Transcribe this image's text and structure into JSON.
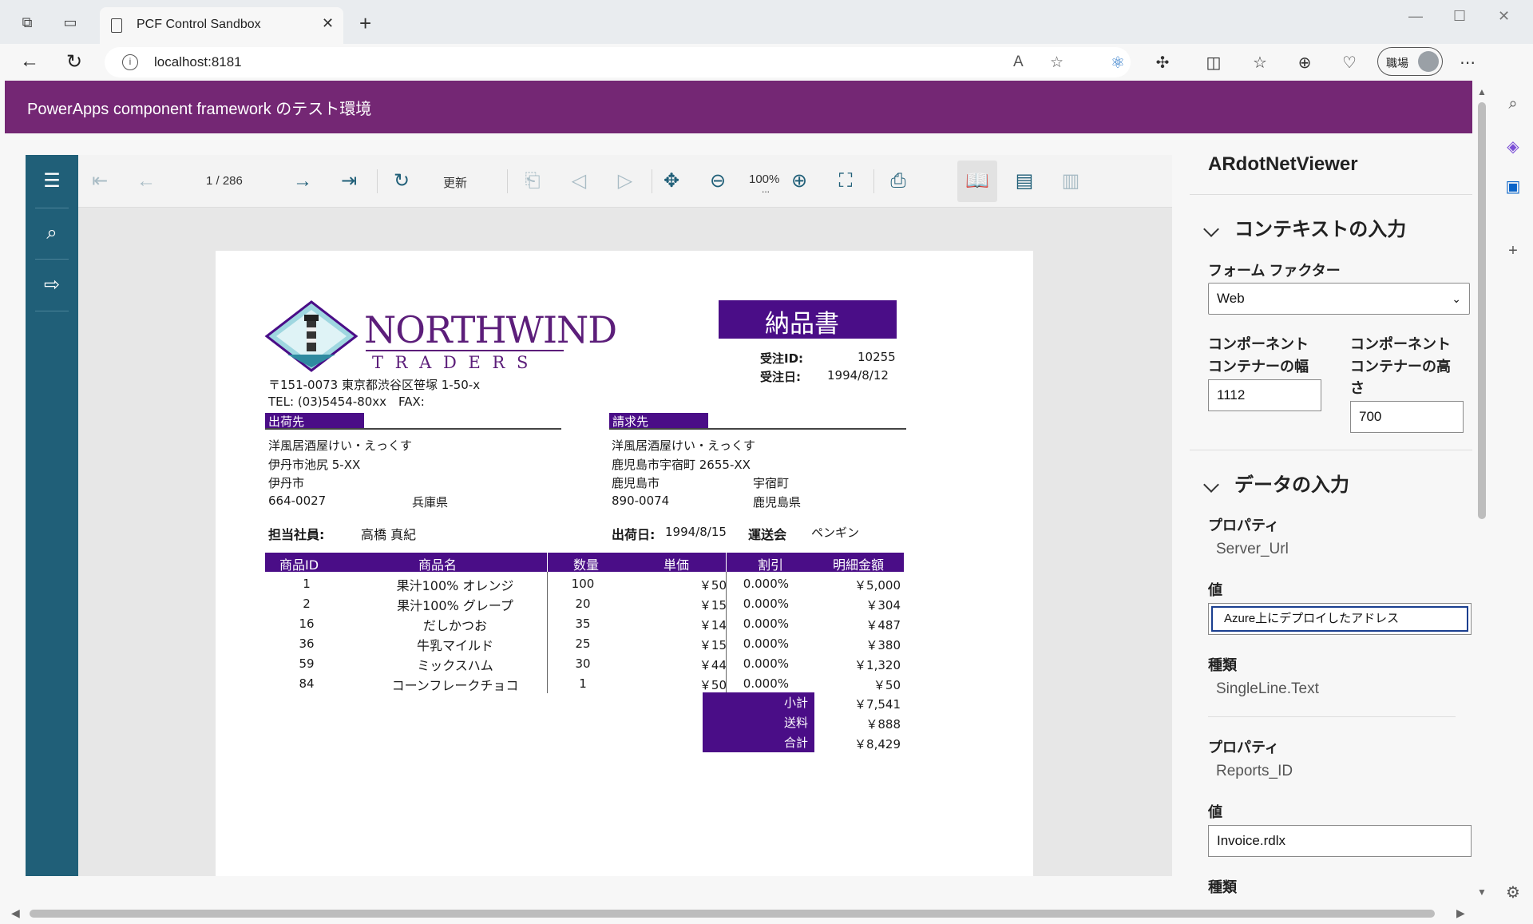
{
  "browser": {
    "tab_title": "PCF Control Sandbox",
    "url": "localhost:8181",
    "profile_label": "職場"
  },
  "app": {
    "banner_title": "PowerApps component framework のテスト環境"
  },
  "viewer": {
    "page_indicator": "1 / 286",
    "refresh_label": "更新",
    "zoom": "100%",
    "zoom_sub": "...",
    "accent_color": "#205f78"
  },
  "invoice": {
    "company_name_line1": "NORTHWIND",
    "company_name_line2": "T R A D E R S",
    "address": "〒151-0073 東京都渋谷区笹塚 1-50-x",
    "tel": "TEL: (03)5454-80xx",
    "fax": "FAX:",
    "doc_title": "納品書",
    "order_id_label": "受注ID:",
    "order_id": "10255",
    "order_date_label": "受注日:",
    "order_date": "1994/8/12",
    "ship_to_label": "出荷先",
    "bill_to_label": "請求先",
    "ship_to": {
      "name": "洋風居酒屋けい・えっくす",
      "address": "伊丹市池尻 5-XX",
      "city": "伊丹市",
      "postal": "664-0027",
      "pref": "兵庫県"
    },
    "bill_to": {
      "name": "洋風居酒屋けい・えっくす",
      "address": "鹿児島市宇宿町 2655-XX",
      "city": "鹿児島市",
      "town": "宇宿町",
      "postal": "890-0074",
      "pref": "鹿児島県"
    },
    "staff_label": "担当社員:",
    "staff": "高橋 真紀",
    "ship_date_label": "出荷日:",
    "ship_date": "1994/8/15",
    "carrier_label": "運送会",
    "carrier": "ペンギン",
    "columns": [
      "商品ID",
      "商品名",
      "数量",
      "単価",
      "割引",
      "明細金額"
    ],
    "rows": [
      {
        "id": "1",
        "name": "果汁100% オレンジ",
        "qty": "100",
        "price": "￥50",
        "disc": "0.000%",
        "amount": "￥5,000"
      },
      {
        "id": "2",
        "name": "果汁100% グレープ",
        "qty": "20",
        "price": "￥15",
        "disc": "0.000%",
        "amount": "￥304"
      },
      {
        "id": "16",
        "name": "だしかつお",
        "qty": "35",
        "price": "￥14",
        "disc": "0.000%",
        "amount": "￥487"
      },
      {
        "id": "36",
        "name": "牛乳マイルド",
        "qty": "25",
        "price": "￥15",
        "disc": "0.000%",
        "amount": "￥380"
      },
      {
        "id": "59",
        "name": "ミックスハム",
        "qty": "30",
        "price": "￥44",
        "disc": "0.000%",
        "amount": "￥1,320"
      },
      {
        "id": "84",
        "name": "コーンフレークチョコ",
        "qty": "1",
        "price": "￥50",
        "disc": "0.000%",
        "amount": "￥50"
      }
    ],
    "subtotal_label": "小計",
    "subtotal": "￥7,541",
    "shipping_label": "送料",
    "shipping": "￥888",
    "total_label": "合計",
    "total": "￥8,429",
    "accent_color": "#4a0d87"
  },
  "panel": {
    "title": "ARdotNetViewer",
    "context_section": "コンテキストの入力",
    "form_factor_label": "フォーム ファクター",
    "form_factor_value": "Web",
    "width_label_1": "コンポーネント",
    "width_label_2": "コンテナーの幅",
    "width_value": "1112",
    "height_label_1": "コンポーネント",
    "height_label_2": "コンテナーの高",
    "height_label_3": "さ",
    "height_value": "700",
    "data_section": "データの入力",
    "properties": [
      {
        "prop_label": "プロパティ",
        "prop_name": "Server_Url",
        "value_label": "値",
        "value": "Azure上にデプロイしたアドレス",
        "type_label": "種類",
        "type": "SingleLine.Text"
      },
      {
        "prop_label": "プロパティ",
        "prop_name": "Reports_ID",
        "value_label": "値",
        "value": "Invoice.rdlx",
        "type_label": "種類"
      }
    ]
  }
}
